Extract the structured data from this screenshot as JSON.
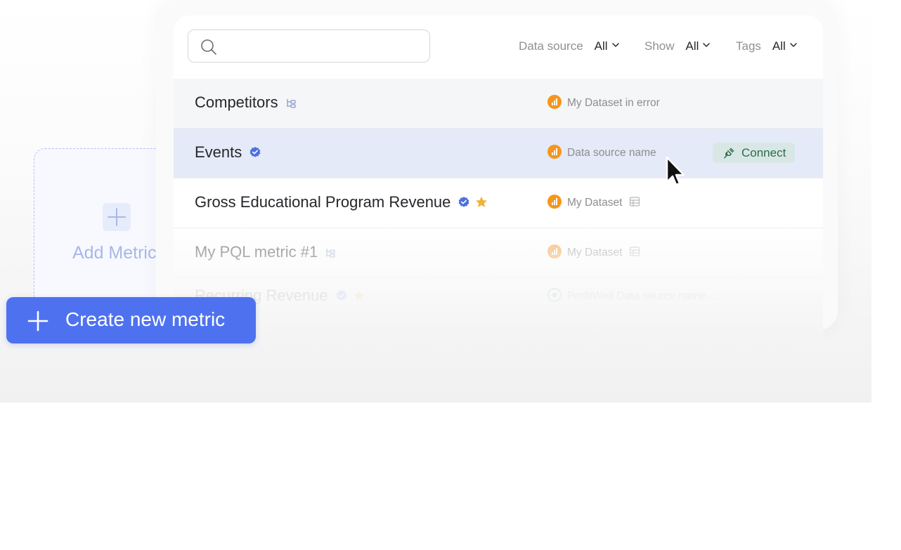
{
  "search": {
    "placeholder": "",
    "value": ""
  },
  "filters": [
    {
      "label": "Data source",
      "value": "All"
    },
    {
      "label": "Show",
      "value": "All"
    },
    {
      "label": "Tags",
      "value": "All"
    }
  ],
  "rows": [
    {
      "name": "Competitors",
      "name_icon": "hierarchy-icon",
      "data_source": "My Dataset in error",
      "state": "normal"
    },
    {
      "name": "Events",
      "name_icon": "verified-badge-icon",
      "data_source": "Data source name",
      "state": "hovered",
      "action": "Connect"
    },
    {
      "name": "Gross Educational Program Revenue",
      "name_icon": "verified-badge-icon",
      "starred": true,
      "data_source": "My Dataset",
      "source_icon": "table-icon",
      "state": "normal"
    },
    {
      "name": "My PQL metric #1",
      "name_icon": "hierarchy-icon",
      "data_source": "My Dataset",
      "source_icon": "table-icon",
      "state": "faded"
    },
    {
      "name": "Recurring Revenue",
      "name_icon": "verified-badge-icon",
      "starred": true,
      "data_source": "ProfitWell Data source name ...",
      "state": "faded"
    }
  ],
  "add_card": {
    "label": "Add Metric"
  },
  "create_button": {
    "label": "Create new metric"
  },
  "colors": {
    "accent": "#4e72ef",
    "verified": "#4e6fe0",
    "star": "#f0b43c",
    "source_icon": "#f5961d",
    "connect_bg": "#d8e7e6",
    "connect_text": "#2c6b47",
    "hover_row": "#e4eaf7"
  }
}
